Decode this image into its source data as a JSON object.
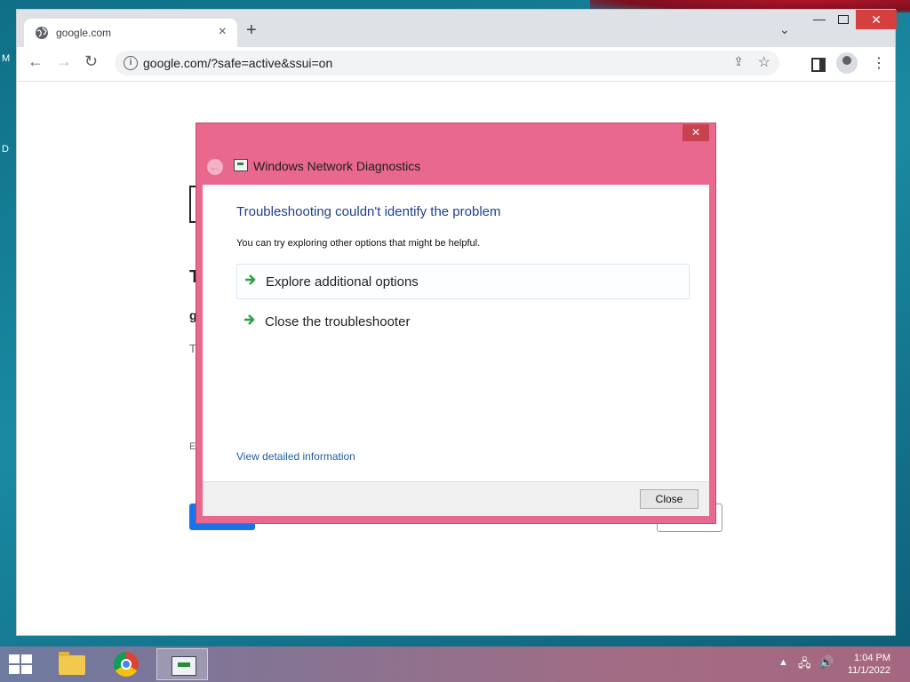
{
  "browser": {
    "tab_title": "google.com",
    "new_tab_symbol": "+",
    "tab_close_symbol": "×",
    "url": "google.com/?safe=active&ssui=on"
  },
  "dialog": {
    "title": "Windows Network Diagnostics",
    "heading": "Troubleshooting couldn't identify the problem",
    "subtext": "You can try exploring other options that might be helpful.",
    "options": [
      {
        "label": "Explore additional options"
      },
      {
        "label": "Close the troubleshooter"
      }
    ],
    "link": "View detailed information",
    "close_button": "Close"
  },
  "taskbar": {
    "time": "1:04 PM",
    "date": "11/1/2022",
    "apps": [
      "file-explorer",
      "chrome",
      "network-diagnostics"
    ]
  },
  "colors": {
    "dialog_frame": "#e8688e",
    "heading_blue": "#1f3f8f",
    "link_blue": "#1f5fa8",
    "arrow_green": "#2ea043"
  }
}
